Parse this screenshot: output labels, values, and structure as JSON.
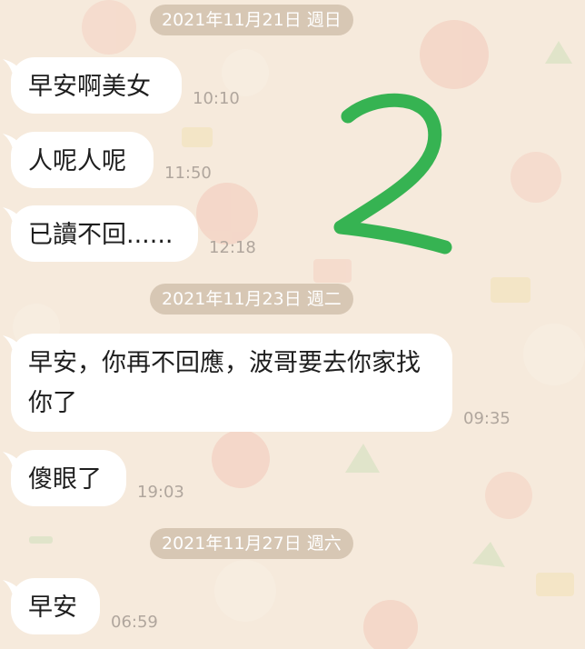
{
  "chat": {
    "date_headers": [
      {
        "label": "2021年11月21日 週日"
      },
      {
        "label": "2021年11月23日 週二"
      },
      {
        "label": "2021年11月27日 週六"
      }
    ],
    "messages": [
      {
        "text": "早安啊美女",
        "time": "10:10"
      },
      {
        "text": "人呢人呢",
        "time": "11:50"
      },
      {
        "text": "已讀不回......",
        "time": "12:18"
      },
      {
        "text": "早安，你再不回應，波哥要去你家找你了",
        "time": "09:35"
      },
      {
        "text": "傻眼了",
        "time": "19:03"
      },
      {
        "text": "早安",
        "time": "06:59"
      }
    ]
  },
  "annotation": {
    "handwritten_digit": "2",
    "color": "#2bb04a"
  },
  "colors": {
    "background": "#f6eadc",
    "bubble": "#ffffff",
    "date_pill": "#d0beaa",
    "timestamp": "#b0a69d"
  }
}
